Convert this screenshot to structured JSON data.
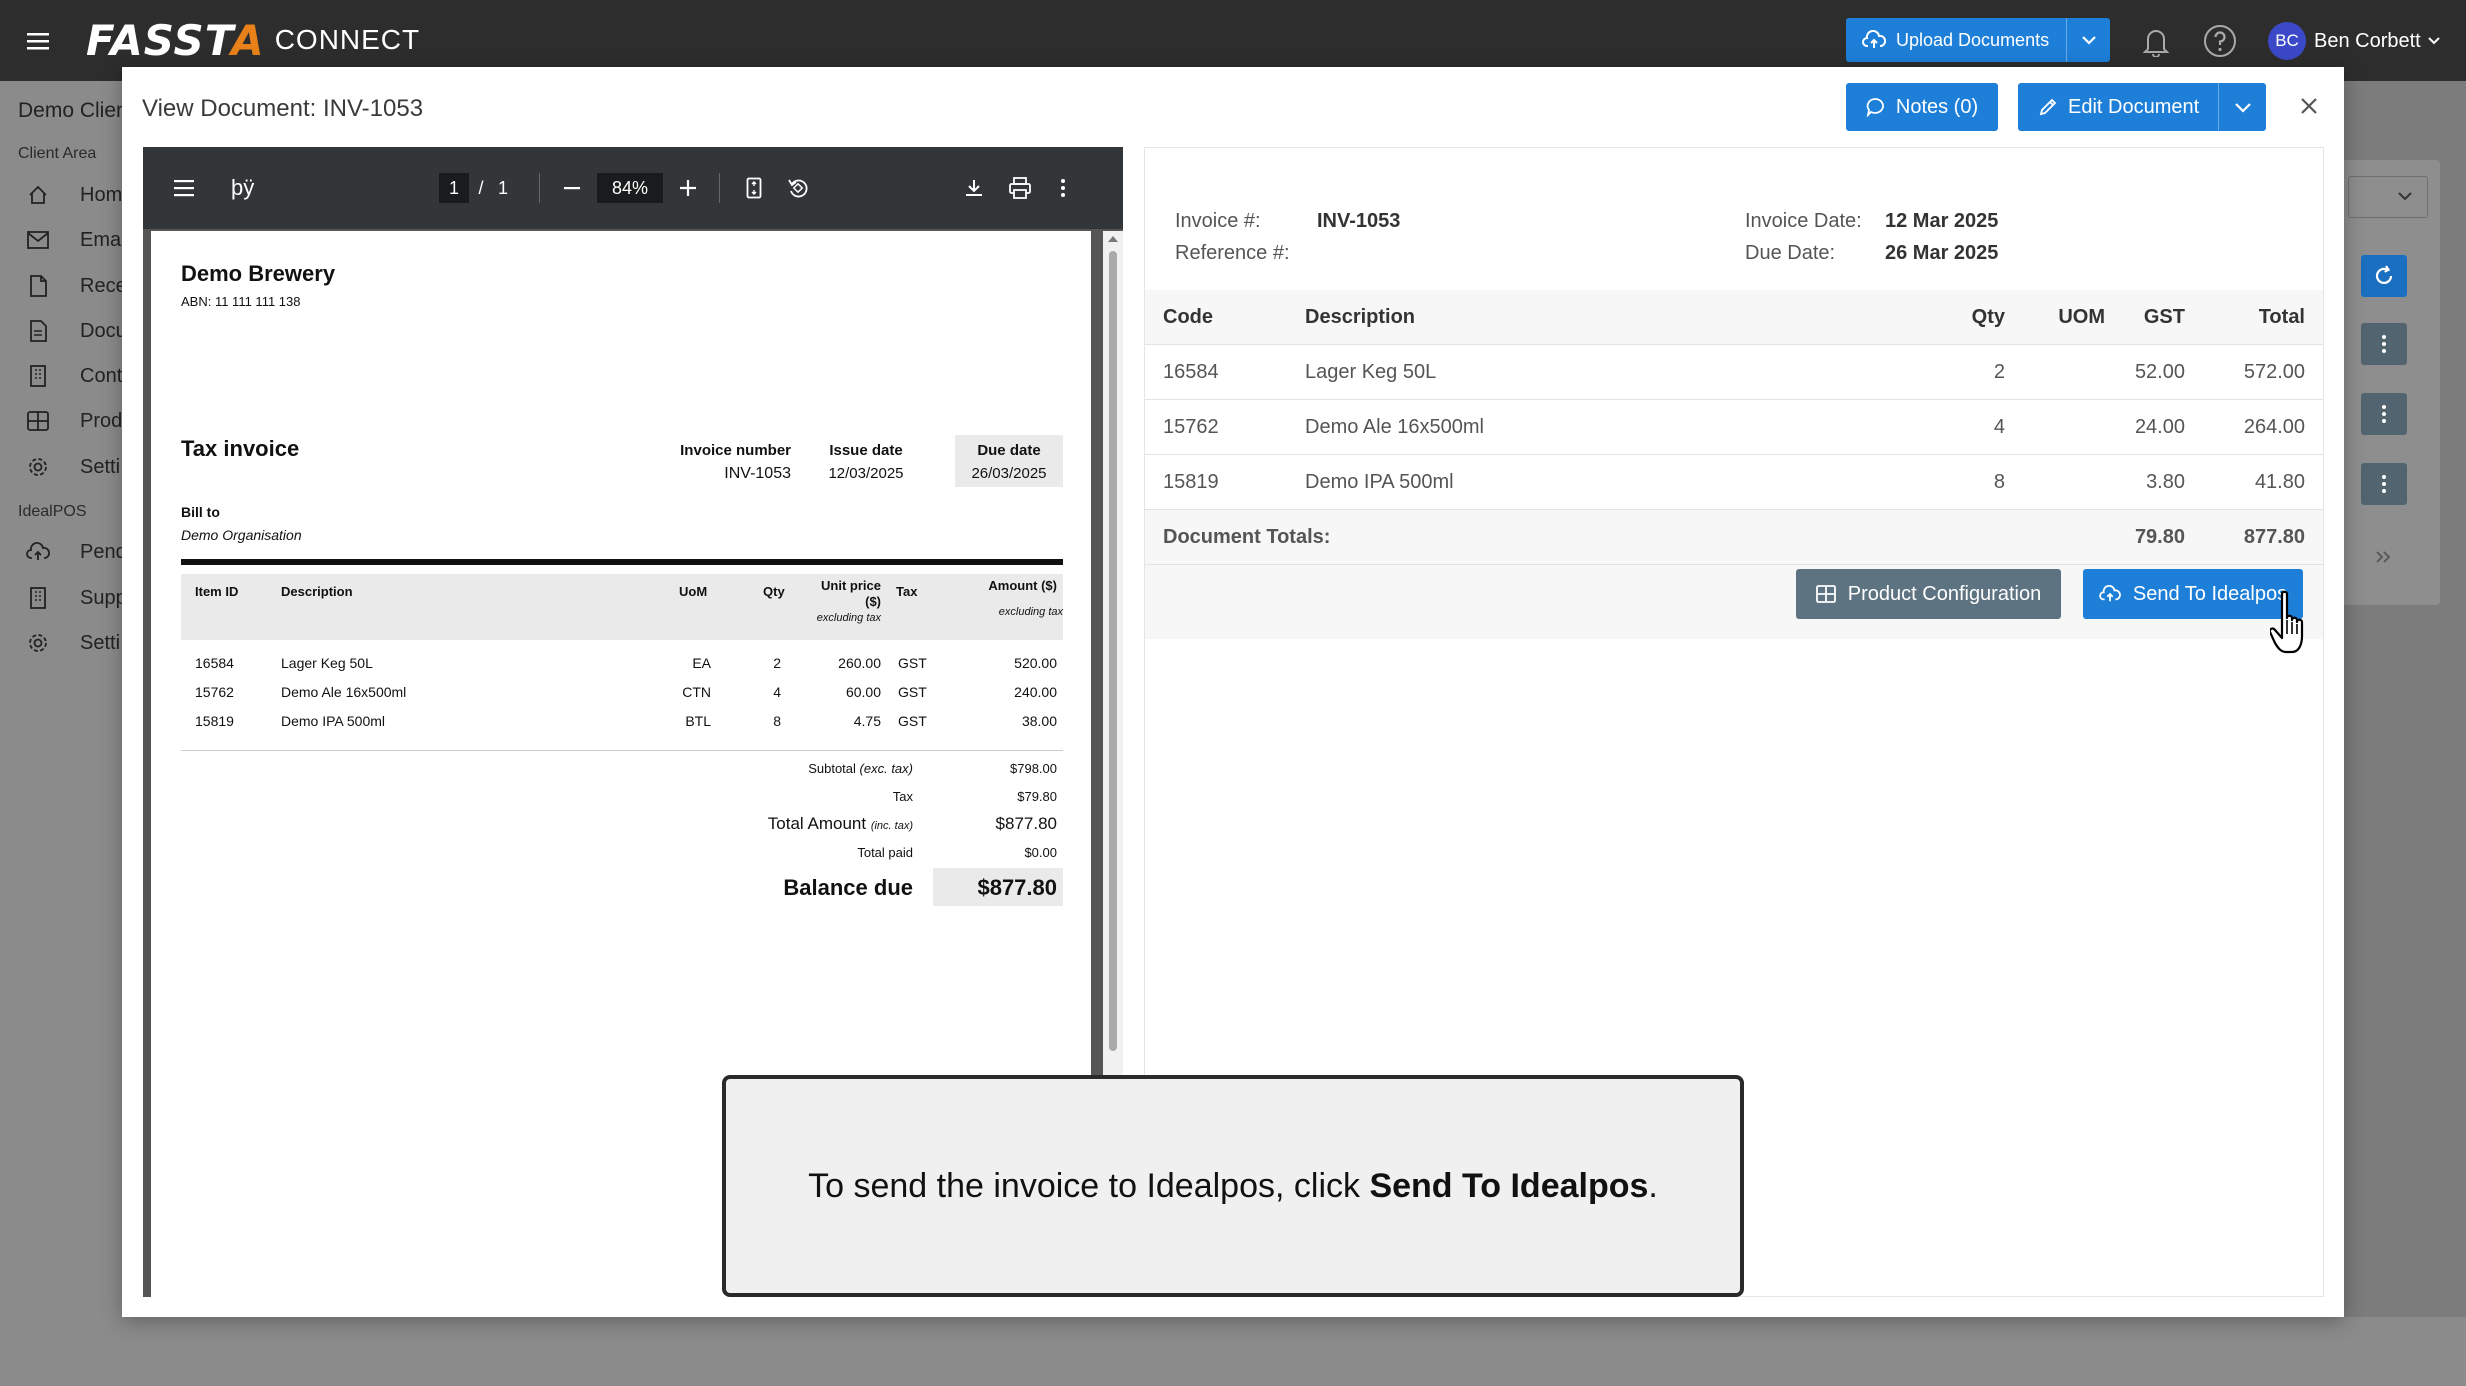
{
  "topbar": {
    "logo_main": "FASST",
    "logo_accent": "A",
    "logo_sub": "CONNECT",
    "upload_label": "Upload Documents",
    "user_initials": "BC",
    "user_name": "Ben Corbett"
  },
  "sidebar": {
    "client": "Demo Client",
    "section_client": "Client Area",
    "section_idealpos": "IdealPOS",
    "items": [
      {
        "label": "Hom",
        "icon": "home-icon"
      },
      {
        "label": "Emai",
        "icon": "mail-icon"
      },
      {
        "label": "Rece",
        "icon": "file-icon"
      },
      {
        "label": "Docu",
        "icon": "document-icon"
      },
      {
        "label": "Cont",
        "icon": "building-icon"
      },
      {
        "label": "Prod",
        "icon": "grid-icon"
      },
      {
        "label": "Setti",
        "icon": "gear-icon"
      }
    ],
    "idealpos_items": [
      {
        "label": "Pend",
        "icon": "cloud-upload-icon"
      },
      {
        "label": "Supp",
        "icon": "building-icon"
      },
      {
        "label": "Setti",
        "icon": "gear-icon"
      }
    ]
  },
  "modal": {
    "title": "View Document: INV-1053",
    "notes_label": "Notes (0)",
    "edit_label": "Edit Document"
  },
  "pdf_toolbar": {
    "sidebar_icon": "menu-icon",
    "title": "þÿ",
    "page_current": "1",
    "page_sep": "/",
    "page_total": "1",
    "zoom": "84%"
  },
  "pdf": {
    "company": "Demo Brewery",
    "abn": "ABN: 11 111 111 138",
    "doc_title": "Tax invoice",
    "invoice_number_label": "Invoice number",
    "invoice_number": "INV-1053",
    "issue_date_label": "Issue date",
    "issue_date": "12/03/2025",
    "due_date_label": "Due date",
    "due_date": "26/03/2025",
    "bill_to_label": "Bill to",
    "bill_to": "Demo Organisation",
    "headers": {
      "item_id": "Item ID",
      "description": "Description",
      "uom": "UoM",
      "qty": "Qty",
      "unit_price": "Unit price",
      "unit_price_2": "($)",
      "unit_price_note": "excluding tax",
      "tax": "Tax",
      "amount": "Amount ($)",
      "amount_note": "excluding tax"
    },
    "rows": [
      {
        "id": "16584",
        "desc": "Lager Keg 50L",
        "uom": "EA",
        "qty": "2",
        "price": "260.00",
        "tax": "GST",
        "amount": "520.00"
      },
      {
        "id": "15762",
        "desc": "Demo Ale 16x500ml",
        "uom": "CTN",
        "qty": "4",
        "price": "60.00",
        "tax": "GST",
        "amount": "240.00"
      },
      {
        "id": "15819",
        "desc": "Demo IPA 500ml",
        "uom": "BTL",
        "qty": "8",
        "price": "4.75",
        "tax": "GST",
        "amount": "38.00"
      }
    ],
    "subtotal_label": "Subtotal",
    "subtotal_note": "(exc. tax)",
    "subtotal": "$798.00",
    "tax_label": "Tax",
    "tax": "$79.80",
    "total_label": "Total Amount",
    "total_note": "(inc. tax)",
    "total": "$877.80",
    "paid_label": "Total paid",
    "paid": "$0.00",
    "balance_label": "Balance due",
    "balance": "$877.80"
  },
  "details": {
    "invoice_label": "Invoice #:",
    "invoice_value": "INV-1053",
    "reference_label": "Reference #:",
    "invoice_date_label": "Invoice Date:",
    "invoice_date_value": "12 Mar 2025",
    "due_date_label": "Due Date:",
    "due_date_value": "26 Mar 2025",
    "columns": {
      "code": "Code",
      "description": "Description",
      "qty": "Qty",
      "uom": "UOM",
      "gst": "GST",
      "total": "Total"
    },
    "rows": [
      {
        "code": "16584",
        "description": "Lager Keg 50L",
        "qty": "2",
        "uom": "",
        "gst": "52.00",
        "total": "572.00"
      },
      {
        "code": "15762",
        "description": "Demo Ale 16x500ml",
        "qty": "4",
        "uom": "",
        "gst": "24.00",
        "total": "264.00"
      },
      {
        "code": "15819",
        "description": "Demo IPA 500ml",
        "qty": "8",
        "uom": "",
        "gst": "3.80",
        "total": "41.80"
      }
    ],
    "totals_label": "Document Totals:",
    "totals_gst": "79.80",
    "totals_total": "877.80",
    "product_config_label": "Product Configuration",
    "send_label": "Send To Idealpos"
  },
  "callout": {
    "text_before": "To send the invoice to Idealpos, click ",
    "text_bold": "Send To Idealpos",
    "text_after": "."
  },
  "colors": {
    "primary": "#1e7fd9",
    "topbar": "#2d2d2d",
    "secondary_button": "#5e7382",
    "accent": "#e8811a",
    "avatar": "#3b49c9"
  }
}
